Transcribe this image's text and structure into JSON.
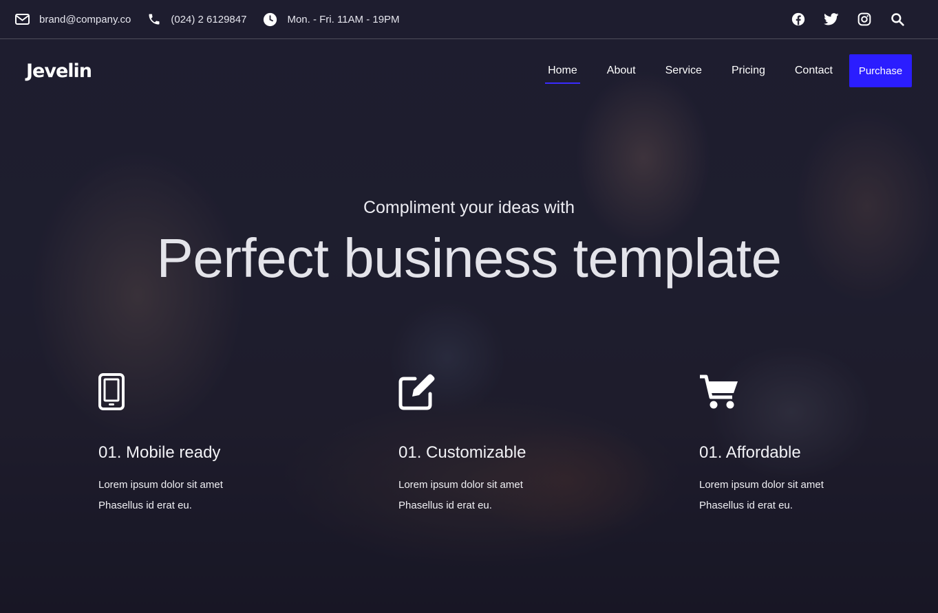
{
  "topbar": {
    "email": "brand@company.co",
    "phone": "(024) 2 6129847",
    "hours": "Mon. - Fri. 11AM - 19PM",
    "social_icons": [
      "facebook-icon",
      "twitter-icon",
      "instagram-icon",
      "search-icon"
    ]
  },
  "nav": {
    "logo": "Jevelin",
    "items": [
      {
        "label": "Home",
        "active": true
      },
      {
        "label": "About"
      },
      {
        "label": "Service"
      },
      {
        "label": "Pricing"
      },
      {
        "label": "Contact"
      }
    ],
    "purchase_label": "Purchase"
  },
  "hero": {
    "subtitle": "Compliment your ideas with",
    "title": "Perfect business template"
  },
  "features": [
    {
      "icon": "mobile-icon",
      "title": "01. Mobile ready",
      "line1": "Lorem ipsum dolor sit amet",
      "line2": "Phasellus id erat eu."
    },
    {
      "icon": "edit-icon",
      "title": "01. Customizable",
      "line1": "Lorem ipsum dolor sit amet",
      "line2": "Phasellus id erat eu."
    },
    {
      "icon": "cart-icon",
      "title": "01. Affordable",
      "line1": "Lorem ipsum dolor sit amet",
      "line2": "Phasellus id erat eu."
    }
  ],
  "colors": {
    "accent": "#2b1dff",
    "text": "#ffffff",
    "overlay": "#141428"
  }
}
